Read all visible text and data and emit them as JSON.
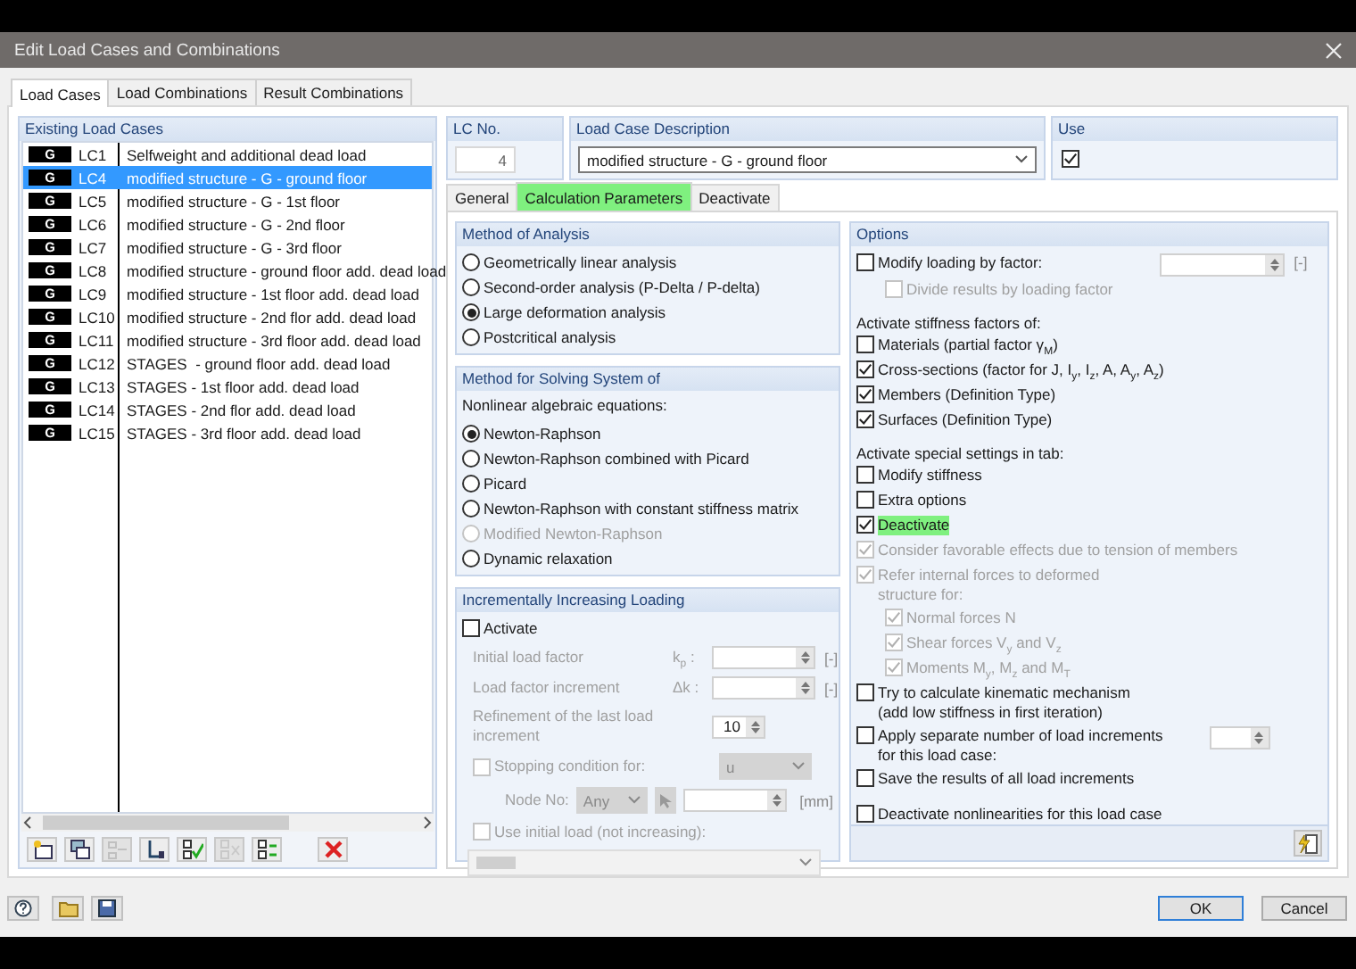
{
  "window": {
    "title": "Edit Load Cases and Combinations"
  },
  "tabs": [
    {
      "label": "Load Cases",
      "selected": true
    },
    {
      "label": "Load Combinations",
      "selected": false
    },
    {
      "label": "Result Combinations",
      "selected": false
    }
  ],
  "load_cases": {
    "title": "Existing Load Cases",
    "rows": [
      {
        "badge": "G",
        "id": "LC1",
        "description": "Selfweight and additional dead load",
        "selected": false
      },
      {
        "badge": "G",
        "id": "LC4",
        "description": "modified structure - G - ground floor",
        "selected": true
      },
      {
        "badge": "G",
        "id": "LC5",
        "description": "modified structure - G - 1st floor",
        "selected": false
      },
      {
        "badge": "G",
        "id": "LC6",
        "description": "modified structure - G - 2nd floor",
        "selected": false
      },
      {
        "badge": "G",
        "id": "LC7",
        "description": "modified structure - G - 3rd floor",
        "selected": false
      },
      {
        "badge": "G",
        "id": "LC8",
        "description": "modified structure - ground floor add. dead load",
        "selected": false
      },
      {
        "badge": "G",
        "id": "LC9",
        "description": "modified structure - 1st floor add. dead load",
        "selected": false
      },
      {
        "badge": "G",
        "id": "LC10",
        "description": "modified structure - 2nd flor add. dead load",
        "selected": false
      },
      {
        "badge": "G",
        "id": "LC11",
        "description": "modified structure - 3rd floor add. dead load",
        "selected": false
      },
      {
        "badge": "G",
        "id": "LC12",
        "description": "STAGES  - ground floor add. dead load",
        "selected": false
      },
      {
        "badge": "G",
        "id": "LC13",
        "description": "STAGES - 1st floor add. dead load",
        "selected": false
      },
      {
        "badge": "G",
        "id": "LC14",
        "description": "STAGES - 2nd flor add. dead load",
        "selected": false
      },
      {
        "badge": "G",
        "id": "LC15",
        "description": "STAGES - 3rd floor add. dead load",
        "selected": false
      }
    ],
    "toolbar": [
      {
        "disabled": false
      },
      {
        "disabled": false
      },
      {
        "disabled": true
      },
      {
        "disabled": false
      },
      {
        "disabled": false
      },
      {
        "disabled": true
      },
      {
        "disabled": false
      },
      {
        "disabled": false
      }
    ]
  },
  "lc_no": {
    "label": "LC No.",
    "value": "4"
  },
  "description": {
    "label": "Load Case Description",
    "value": "modified structure - G - ground floor"
  },
  "use": {
    "label": "Use",
    "checked": true
  },
  "subtabs": [
    {
      "label": "General",
      "selected": false,
      "highlighted": false
    },
    {
      "label": "Calculation Parameters",
      "selected": true,
      "highlighted": true
    },
    {
      "label": "Deactivate",
      "selected": false,
      "highlighted": false
    }
  ],
  "method_of_analysis": {
    "title": "Method of Analysis",
    "options": [
      {
        "label": "Geometrically linear analysis",
        "selected": false,
        "disabled": false
      },
      {
        "label": "Second-order analysis (P-Delta / P-delta)",
        "selected": false,
        "disabled": false
      },
      {
        "label": "Large deformation analysis",
        "selected": true,
        "disabled": false
      },
      {
        "label": "Postcritical analysis",
        "selected": false,
        "disabled": false
      }
    ]
  },
  "solving": {
    "title": "Method for Solving System of",
    "subtitle": "Nonlinear algebraic equations:",
    "options": [
      {
        "label": "Newton-Raphson",
        "selected": true,
        "disabled": false
      },
      {
        "label": "Newton-Raphson combined with Picard",
        "selected": false,
        "disabled": false
      },
      {
        "label": "Picard",
        "selected": false,
        "disabled": false
      },
      {
        "label": "Newton-Raphson with constant stiffness matrix",
        "selected": false,
        "disabled": false
      },
      {
        "label": "Modified Newton-Raphson",
        "selected": false,
        "disabled": true
      },
      {
        "label": "Dynamic relaxation",
        "selected": false,
        "disabled": false
      }
    ]
  },
  "incremental": {
    "title": "Incrementally Increasing Loading",
    "activate": {
      "label": "Activate",
      "checked": false
    },
    "initial_factor": {
      "label": "Initial load factor",
      "symbol": "k$_{p}$ :",
      "unit": "[-]"
    },
    "increment": {
      "label": "Load factor increment",
      "symbol": "Δk :",
      "unit": "[-]"
    },
    "refinement": {
      "label": "Refinement of the last load increment",
      "value": "10"
    },
    "stopping": {
      "label": "Stopping condition for:",
      "checked": false,
      "select": "u"
    },
    "node": {
      "label": "Node No:",
      "select": "Any",
      "unit": "[mm]"
    },
    "initial_load": {
      "label": "Use initial load (not increasing):",
      "checked": false
    }
  },
  "options": {
    "title": "Options",
    "items": [
      {
        "kind": "checkbox_spinner",
        "label": "Modify loading by factor:",
        "checked": false,
        "disabled": false,
        "highlighted": false,
        "unit": "[-]",
        "children": [
          {
            "kind": "checkbox",
            "label": "Divide results by loading factor",
            "checked": false,
            "disabled": true,
            "highlighted": false
          }
        ]
      },
      {
        "kind": "heading",
        "label": "Activate stiffness factors of:"
      },
      {
        "kind": "checkbox",
        "label": "Materials (partial factor γ$_{M}$)",
        "checked": false,
        "disabled": false,
        "highlighted": false
      },
      {
        "kind": "checkbox",
        "label": "Cross-sections (factor for J, I$_{y}$, I$_{z}$, A, A$_{y}$, A$_{z}$)",
        "checked": true,
        "disabled": false,
        "highlighted": false
      },
      {
        "kind": "checkbox",
        "label": "Members (Definition Type)",
        "checked": true,
        "disabled": false,
        "highlighted": false
      },
      {
        "kind": "checkbox",
        "label": "Surfaces (Definition Type)",
        "checked": true,
        "disabled": false,
        "highlighted": false
      },
      {
        "kind": "heading",
        "label": "Activate special settings in tab:"
      },
      {
        "kind": "checkbox",
        "label": "Modify stiffness",
        "checked": false,
        "disabled": false,
        "highlighted": false
      },
      {
        "kind": "checkbox",
        "label": "Extra options",
        "checked": false,
        "disabled": false,
        "highlighted": false
      },
      {
        "kind": "checkbox",
        "label": "Deactivate",
        "checked": true,
        "disabled": false,
        "highlighted": true
      },
      {
        "kind": "checkbox",
        "label": "Consider favorable effects due to tension of members",
        "checked": true,
        "disabled": true,
        "highlighted": false
      },
      {
        "kind": "checkbox",
        "label": "Refer internal forces to deformed\nstructure for:",
        "checked": true,
        "disabled": true,
        "highlighted": false,
        "children": [
          {
            "kind": "checkbox",
            "label": "Normal forces N",
            "checked": true,
            "disabled": true,
            "highlighted": false
          },
          {
            "kind": "checkbox",
            "label": "Shear forces V$_{y}$ and V$_{z}$",
            "checked": true,
            "disabled": true,
            "highlighted": false
          },
          {
            "kind": "checkbox",
            "label": "Moments M$_{y}$, M$_{z}$ and M$_{T}$",
            "checked": true,
            "disabled": true,
            "highlighted": false
          }
        ]
      },
      {
        "kind": "checkbox",
        "label": "Try to calculate kinematic mechanism\n(add low stiffness in first iteration)",
        "checked": false,
        "disabled": false,
        "highlighted": false
      },
      {
        "kind": "checkbox_spinner",
        "label": "Apply separate number of load increments\nfor this load case:",
        "checked": false,
        "disabled": false,
        "highlighted": false
      },
      {
        "kind": "checkbox",
        "label": "Save the results of all load increments",
        "checked": false,
        "disabled": false,
        "highlighted": false
      },
      {
        "kind": "checkbox",
        "label": "Deactivate nonlinearities for this load case",
        "checked": false,
        "disabled": false,
        "highlighted": false
      }
    ]
  },
  "buttons": [
    {
      "label": "OK",
      "default": true
    },
    {
      "label": "Cancel",
      "default": false
    }
  ]
}
